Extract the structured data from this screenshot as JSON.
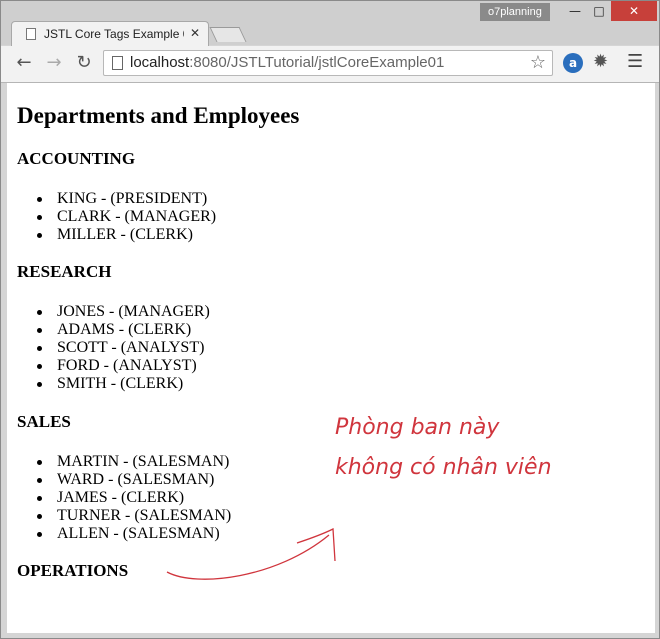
{
  "browser": {
    "profile_name": "o7planning",
    "tab_title": "JSTL Core Tags Example 0",
    "url_host": "localhost",
    "url_path": ":8080/JSTLTutorial/jstlCoreExample01",
    "icons": [
      "back-icon",
      "forward-icon",
      "reload-icon",
      "star-icon",
      "extension-icon",
      "menu-icon"
    ]
  },
  "page": {
    "title": "Departments and Employees",
    "departments": [
      {
        "name": "ACCOUNTING",
        "employees": [
          "KING - (PRESIDENT)",
          "CLARK - (MANAGER)",
          "MILLER - (CLERK)"
        ]
      },
      {
        "name": "RESEARCH",
        "employees": [
          "JONES - (MANAGER)",
          "ADAMS - (CLERK)",
          "SCOTT - (ANALYST)",
          "FORD - (ANALYST)",
          "SMITH - (CLERK)"
        ]
      },
      {
        "name": "SALES",
        "employees": [
          "MARTIN - (SALESMAN)",
          "WARD - (SALESMAN)",
          "JAMES - (CLERK)",
          "TURNER - (SALESMAN)",
          "ALLEN - (SALESMAN)"
        ]
      },
      {
        "name": "OPERATIONS",
        "employees": []
      }
    ]
  },
  "annotation": {
    "line1": "Phòng ban này",
    "line2": "không có nhân viên",
    "color": "#d0353d"
  }
}
